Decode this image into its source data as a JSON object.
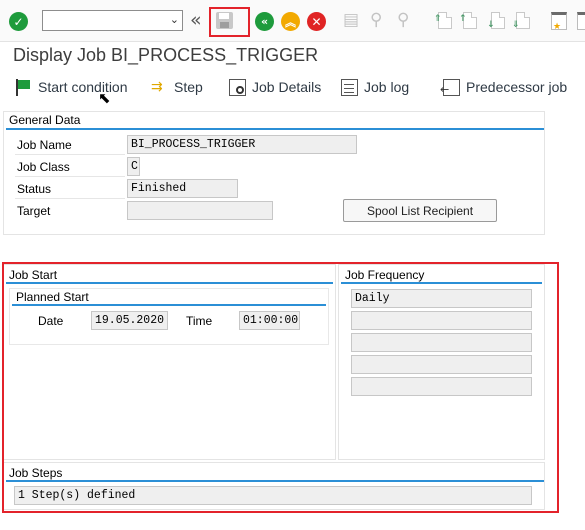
{
  "toolbar": {
    "command_field_value": "",
    "icons": [
      "check-icon",
      "chevron-down-icon",
      "double-chevron-left-icon",
      "save-icon",
      "back-icon",
      "exit-icon",
      "cancel-icon",
      "print-icon",
      "find-icon",
      "find-next-icon",
      "first-page-icon",
      "previous-page-icon",
      "next-page-icon",
      "last-page-icon",
      "create-session-icon",
      "shortcut-icon"
    ],
    "colors": {
      "accent": "#2b8fd6",
      "ok_green": "#1e9b3c",
      "exit_yellow": "#f2a900",
      "cancel_red": "#e02424",
      "highlight": "#e3232b"
    }
  },
  "title": "Display Job BI_PROCESS_TRIGGER",
  "app_toolbar": {
    "start_condition": "Start condition",
    "step": "Step",
    "job_details": "Job Details",
    "job_log": "Job log",
    "predecessor_job": "Predecessor job"
  },
  "general_data": {
    "title": "General Data",
    "job_name_label": "Job Name",
    "job_name_value": "BI_PROCESS_TRIGGER",
    "job_class_label": "Job Class",
    "job_class_value": "C",
    "status_label": "Status",
    "status_value": "Finished",
    "target_label": "Target",
    "target_value": "",
    "spool_button": "Spool List Recipient"
  },
  "job_start": {
    "title": "Job Start",
    "planned_start_title": "Planned Start",
    "date_label": "Date",
    "date_value": "19.05.2020",
    "time_label": "Time",
    "time_value": "01:00:00"
  },
  "job_frequency": {
    "title": "Job Frequency",
    "values": [
      "Daily",
      "",
      "",
      "",
      ""
    ]
  },
  "job_steps": {
    "title": "Job Steps",
    "summary": "1 Step(s) defined"
  }
}
